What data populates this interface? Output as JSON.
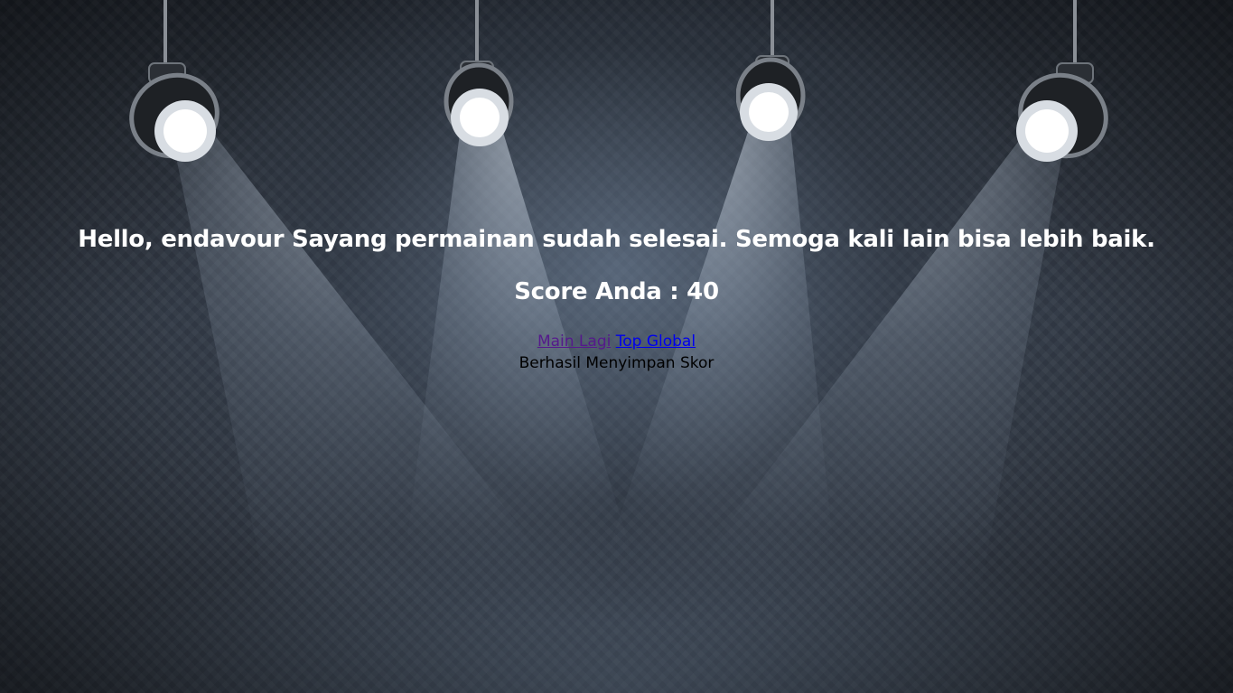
{
  "message": "Hello, endavour Sayang permainan sudah selesai. Semoga kali lain bisa lebih baik.",
  "score_text": "Score Anda : 40",
  "links": {
    "play_again": "Main Lagi",
    "top_global": "Top Global"
  },
  "status_text": "Berhasil Menyimpan Skor",
  "colors": {
    "link_visited": "#551a8b",
    "link_new": "#0000ee",
    "heading": "#ffffff",
    "status": "#000000"
  },
  "decor": {
    "spotlights": [
      "spotlight-icon",
      "spotlight-icon",
      "spotlight-icon",
      "spotlight-icon"
    ]
  }
}
